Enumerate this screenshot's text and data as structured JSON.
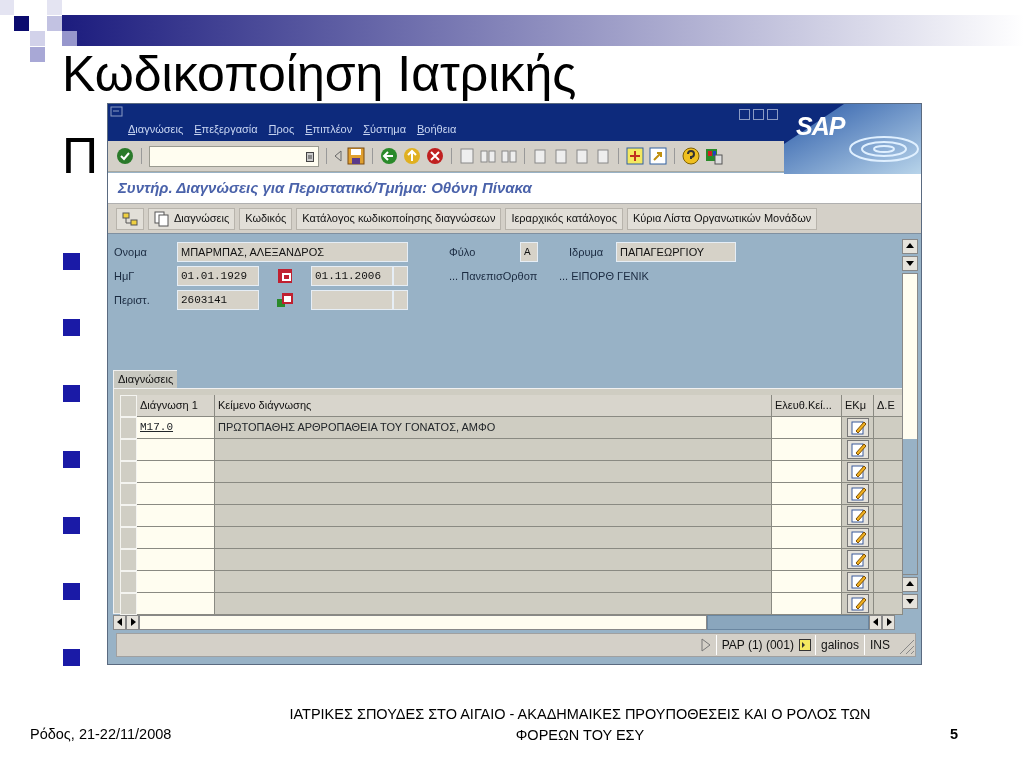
{
  "slide": {
    "title_lines": [
      "Κωδικοποίηση Ιατρικής",
      "Π"
    ],
    "bullets": [
      {
        "kind": "square"
      },
      {
        "kind": "square"
      },
      {
        "kind": "square"
      },
      {
        "kind": "square"
      },
      {
        "kind": "square"
      },
      {
        "kind": "square"
      },
      {
        "kind": "square"
      }
    ],
    "footer": {
      "place_date": "Ρόδος, 21-22/11/2008",
      "caption": "ΙΑΤΡΙΚΕΣ ΣΠΟΥΔΕΣ ΣΤΟ ΑΙΓΑΙΟ - ΑΚΑΔΗΜΑΙΚΕΣ ΠΡΟΥΠΟΘΕΣΕΙΣ ΚΑΙ Ο ΡΟΛΟΣ ΤΩΝ ΦΟΡΕΩΝ ΤΟΥ ΕΣΥ",
      "page": "5"
    }
  },
  "sap_window": {
    "logo": "SAP",
    "menu": [
      "Διαγνώσεις",
      "Επεξεργασία",
      "Προς",
      "Επιπλέον",
      "Σύστημα",
      "Βοήθεια"
    ],
    "screen_title": "Συντήρ. Διαγνώσεις για Περιστατικό/Τμήμα: Οθόνη Πίνακα",
    "app_buttons": [
      {
        "kind": "icon"
      },
      {
        "kind": "icon_text",
        "label": "Διαγνώσεις"
      },
      {
        "kind": "text",
        "label": "Κωδικός"
      },
      {
        "kind": "text",
        "label": "Κατάλογος κωδικοποίησης διαγνώσεων"
      },
      {
        "kind": "text",
        "label": "Ιεραρχικός κατάλογος"
      },
      {
        "kind": "text",
        "label": "Κύρια Λίστα Οργανωτικών Μονάδων"
      }
    ],
    "header_fields": {
      "name": {
        "label": "Ονομα",
        "value": "ΜΠΑΡΜΠΑΣ, ΑΛΕΞΑΝΔΡΟΣ"
      },
      "sex": {
        "label": "Φύλο",
        "value": "Α"
      },
      "institution": {
        "label": "Ιδρυμα",
        "value": "ΠΑΠΑΓΕΩΡΓΙΟΥ"
      },
      "birth_date": {
        "label": "ΗμΓ",
        "value": "01.01.1929"
      },
      "date_2": {
        "value": "01.11.2006"
      },
      "case": {
        "label": "Περιστ.",
        "value": "2603141"
      },
      "caption_1": "... ΠανεπισΟρθοπ",
      "caption_2": "... ΕΙΠΟΡΘ ΓΕΝΙΚ"
    },
    "diagnoses_tab": "Διαγνώσεις",
    "table": {
      "columns": [
        "Διάγνωση 1",
        "Κείμενο διάγνωσης",
        "Ελευθ.Κεί...",
        "ΕΚμ",
        "Δ.Ε"
      ],
      "rows": [
        {
          "kind": "entry",
          "code": "M17.0",
          "text": "ΠΡΩΤΟΠΑΘΗΣ ΑΡΘΡΟΠΑΘΕΙΑ ΤΟΥ ΓΟΝΑΤΟΣ, ΑΜΦΟ"
        },
        {
          "kind": "empty"
        },
        {
          "kind": "empty"
        },
        {
          "kind": "empty"
        },
        {
          "kind": "empty"
        },
        {
          "kind": "empty"
        },
        {
          "kind": "empty"
        },
        {
          "kind": "empty"
        },
        {
          "kind": "empty"
        }
      ]
    },
    "status_bar": {
      "system": "PAP (1) (001)",
      "user": "galinos",
      "mode": "INS"
    }
  }
}
